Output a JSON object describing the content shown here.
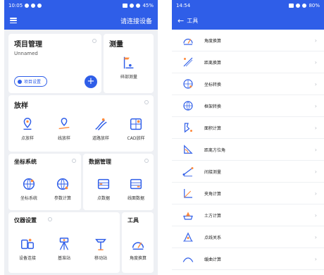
{
  "left": {
    "status": {
      "time": "10:05",
      "battery": "45%"
    },
    "appbar": {
      "action": "请连接设备"
    },
    "project": {
      "title": "项目管理",
      "name": "Unnamed",
      "settings_label": "项目设置",
      "add_label": "+"
    },
    "survey": {
      "title": "测量",
      "items": [
        {
          "label": "碎部测量",
          "icon": "detail-survey-icon"
        }
      ]
    },
    "stakeout": {
      "title": "放样",
      "items": [
        {
          "label": "点放样",
          "icon": "point-stakeout-icon"
        },
        {
          "label": "线放样",
          "icon": "line-stakeout-icon"
        },
        {
          "label": "道路放样",
          "icon": "road-stakeout-icon"
        },
        {
          "label": "CAD放样",
          "icon": "cad-stakeout-icon"
        }
      ]
    },
    "coords": {
      "title": "坐标系统",
      "items": [
        {
          "label": "坐标系统",
          "icon": "globe-icon"
        },
        {
          "label": "参数计算",
          "icon": "globe-compute-icon"
        }
      ]
    },
    "data": {
      "title": "数据管理",
      "items": [
        {
          "label": "点数据",
          "icon": "point-data-icon"
        },
        {
          "label": "线面数据",
          "icon": "line-data-icon"
        }
      ]
    },
    "device": {
      "title": "仪器设置",
      "items": [
        {
          "label": "设备连接",
          "icon": "device-connect-icon"
        },
        {
          "label": "基准站",
          "icon": "base-station-icon"
        },
        {
          "label": "移动站",
          "icon": "rover-icon"
        }
      ]
    },
    "tools": {
      "title": "工具",
      "items": [
        {
          "label": "角度换算",
          "icon": "angle-convert-icon"
        }
      ]
    },
    "colors": {
      "primary": "#2f5ee8",
      "background": "#eef0f4"
    }
  },
  "right": {
    "status": {
      "time": "14:54",
      "battery": "80%"
    },
    "appbar": {
      "title": "工具"
    },
    "items": [
      {
        "label": "角度换算",
        "icon": "angle-convert-icon"
      },
      {
        "label": "距离换算",
        "icon": "distance-convert-icon"
      },
      {
        "label": "坐标转换",
        "icon": "coordinate-convert-icon"
      },
      {
        "label": "框架转换",
        "icon": "frame-convert-icon"
      },
      {
        "label": "面积计算",
        "icon": "area-calc-icon"
      },
      {
        "label": "距离方位角",
        "icon": "azimuth-icon"
      },
      {
        "label": "间接测量",
        "icon": "indirect-measure-icon"
      },
      {
        "label": "夹角计算",
        "icon": "included-angle-icon"
      },
      {
        "label": "土方计算",
        "icon": "earthwork-icon"
      },
      {
        "label": "点线关系",
        "icon": "point-line-icon"
      },
      {
        "label": "缓曲计算",
        "icon": "curve-calc-icon"
      }
    ]
  }
}
